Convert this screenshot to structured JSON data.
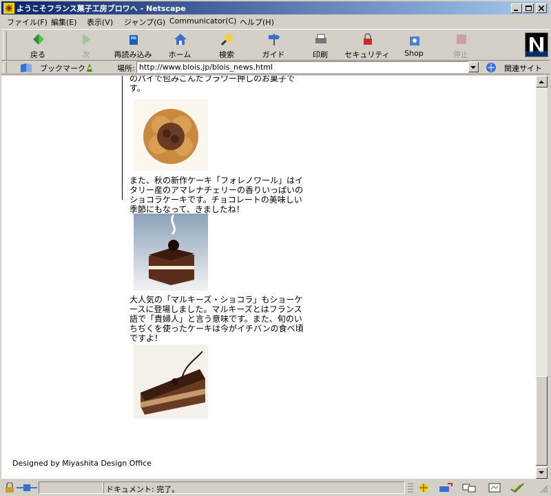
{
  "window": {
    "title": "ようこそフランス菓子工房ブロワへ - Netscape"
  },
  "menu": {
    "items": [
      "ファイル(F)",
      "編集(E)",
      "表示(V)",
      "ジャンプ(G)",
      "Communicator(C)",
      "ヘルプ(H)"
    ]
  },
  "toolbar": {
    "back": "戻る",
    "forward": "次",
    "reload": "再読み込み",
    "home": "ホーム",
    "search": "検索",
    "guide": "ガイド",
    "print": "印刷",
    "security": "セキュリティ",
    "shop": "Shop",
    "stop": "停止"
  },
  "location": {
    "bookmarks_label": "ブックマーク",
    "location_label": "場所:",
    "url": "http://www.blois.jp/blois_news.html",
    "related_label": "関連サイト"
  },
  "content": {
    "top_text": "のパイで包みこんだフラワー押しのお菓子です。",
    "para1": "また、秋の新作ケーキ「フォレノワール」はイタリー産のアマレナチェリーの香りいっぱいのショコラケーキです。チョコレートの美味しい季節にもなって、きましたね！",
    "para2": "大人気の「マルキーズ・ショコラ」もショーケースに登場しました。マルキーズとはフランス語で「貴婦人」と言う意味です。また、旬のいちぢくを使ったケーキは今がイチバンの食べ頃ですよ！",
    "footer": "Designed by Miyashita Design Office"
  },
  "status": {
    "text": "ドキュメント: 完了。"
  },
  "colors": {
    "title_active": "#0a246a",
    "chrome": "#d4d0c8",
    "page_bg": "#ffffff"
  }
}
